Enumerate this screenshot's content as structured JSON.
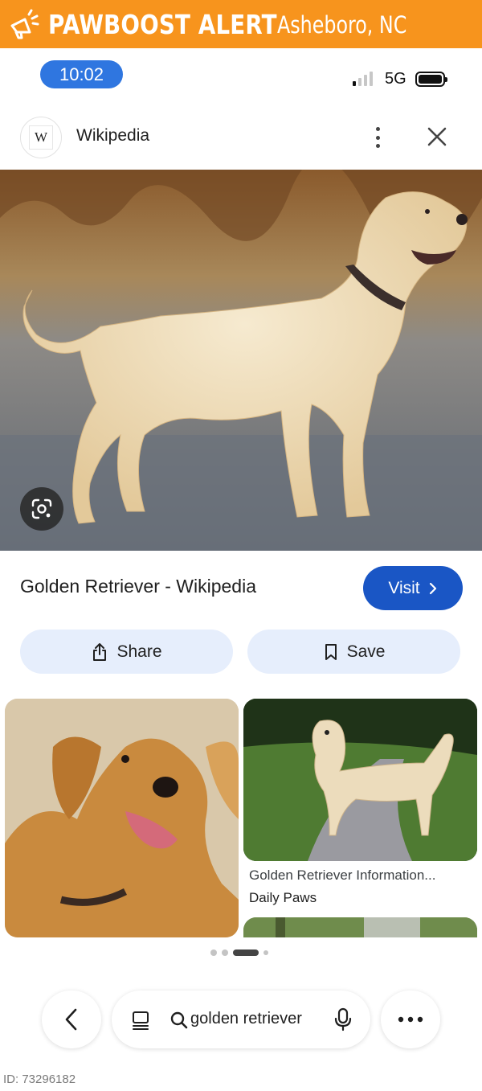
{
  "banner": {
    "brand": "PAWBOOST ALERT",
    "city": "Asheboro, NC",
    "color": "#f7941d",
    "icon": "megaphone-icon"
  },
  "status_bar": {
    "time": "10:02",
    "network": "5G",
    "signal_bars_on": 1,
    "signal_bars_total": 4,
    "battery_level": 1.0
  },
  "header": {
    "site_logo_letter": "W",
    "site_name": "Wikipedia"
  },
  "result": {
    "title": "Golden Retriever - Wikipedia",
    "visit_label": "Visit",
    "share_label": "Share",
    "save_label": "Save",
    "accent": "#1a56c5"
  },
  "related": [
    {
      "title": "",
      "source": ""
    },
    {
      "title": "Golden Retriever Information...",
      "source": "Daily Paws"
    }
  ],
  "pagination": {
    "pages": 4,
    "active": 3
  },
  "bottom_bar": {
    "query": "golden retriever"
  },
  "footer": {
    "listing_id": "ID: 73296182"
  }
}
